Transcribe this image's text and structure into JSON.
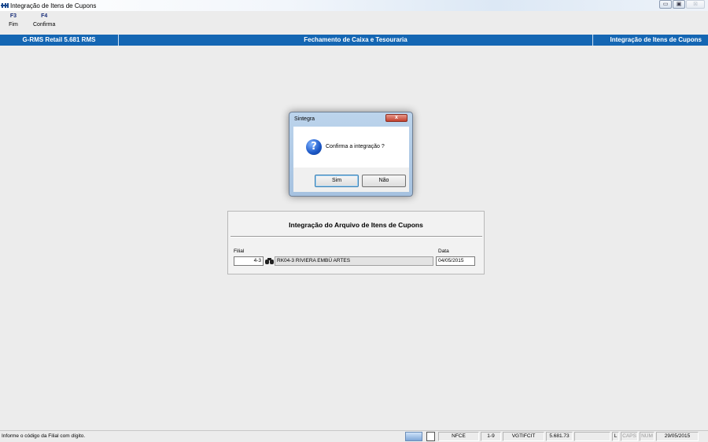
{
  "window": {
    "title": "Integração de Itens de Cupons",
    "controls": [
      "▭",
      "▣",
      "⊠"
    ]
  },
  "toolbar": {
    "keys": [
      {
        "key": "F3",
        "label": "Fim"
      },
      {
        "key": "F4",
        "label": "Confirma"
      }
    ]
  },
  "header_band": {
    "left": "G-RMS Retail 5.681 RMS",
    "center": "Fechamento de Caixa e Tesouraria",
    "right": "Integração de Itens de Cupons"
  },
  "dialog": {
    "title": "Sintegra",
    "close": "x",
    "icon": "question-icon",
    "message": "Confirma a integração ?",
    "yes_label": "Sim",
    "no_label": "Não"
  },
  "form": {
    "title": "Integração do Arquivo de Itens de Cupons",
    "filial_label": "Filial",
    "filial_value": "4-3",
    "filial_name": "RK04-3 RIVIERA EMBÚ ARTES",
    "data_label": "Data",
    "data_value": "04/05/2015"
  },
  "statusbar": {
    "message": "Informe o código da Filial com dígito.",
    "cells": [
      "NFCE",
      "1-9",
      "VGTIFCIT",
      "5.681.73",
      ""
    ],
    "indicators": [
      "L",
      "CAPS",
      "NUM"
    ],
    "date": "29/05/2015"
  }
}
